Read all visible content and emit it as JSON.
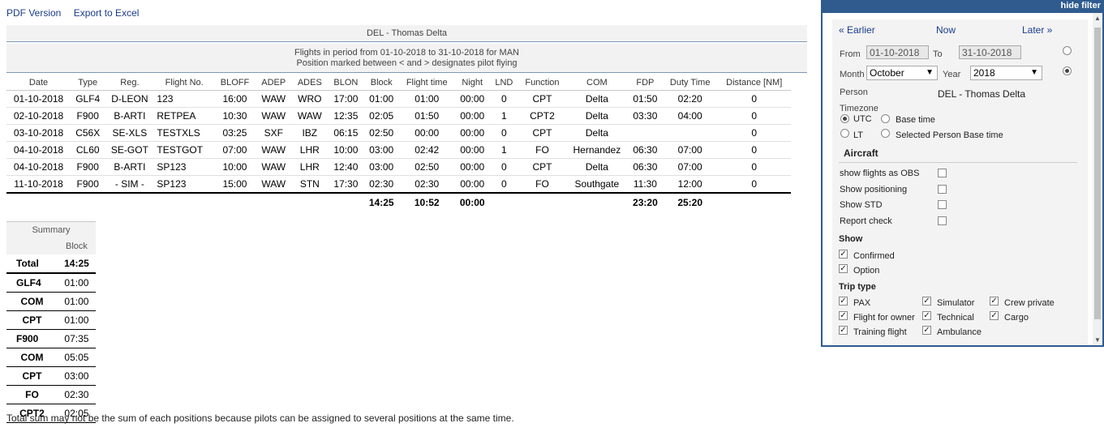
{
  "links": {
    "pdf": "PDF Version",
    "excel": "Export to Excel"
  },
  "report": {
    "person_header": "DEL - Thomas Delta",
    "period_line1": "Flights in period from 01-10-2018 to 31-10-2018 for MAN",
    "period_line2": "Position marked between < and > designates pilot flying",
    "columns": [
      "Date",
      "Type",
      "Reg.",
      "Flight No.",
      "BLOFF",
      "ADEP",
      "ADES",
      "BLON",
      "Block",
      "Flight time",
      "Night",
      "LND",
      "Function",
      "COM",
      "FDP",
      "Duty Time",
      "Distance [NM]"
    ],
    "rows": [
      [
        "01-10-2018",
        "GLF4",
        "D-LEON",
        "123",
        "16:00",
        "WAW",
        "WRO",
        "17:00",
        "01:00",
        "01:00",
        "00:00",
        "0",
        "CPT",
        "Delta",
        "01:50",
        "02:20",
        "0"
      ],
      [
        "02-10-2018",
        "F900",
        "B-ARTI",
        "RETPEA",
        "10:30",
        "WAW",
        "WAW",
        "12:35",
        "02:05",
        "01:50",
        "00:00",
        "1",
        "CPT2",
        "Delta",
        "03:30",
        "04:00",
        "0"
      ],
      [
        "03-10-2018",
        "C56X",
        "SE-XLS",
        "TESTXLS",
        "03:25",
        "SXF",
        "IBZ",
        "06:15",
        "02:50",
        "00:00",
        "00:00",
        "0",
        "CPT",
        "Delta",
        "",
        "",
        "0"
      ],
      [
        "04-10-2018",
        "CL60",
        "SE-GOT",
        "TESTGOT",
        "07:00",
        "WAW",
        "LHR",
        "10:00",
        "03:00",
        "02:42",
        "00:00",
        "1",
        "FO",
        "Hernandez",
        "06:30",
        "07:00",
        "0"
      ],
      [
        "04-10-2018",
        "F900",
        "B-ARTI",
        "SP123",
        "10:00",
        "WAW",
        "LHR",
        "12:40",
        "03:00",
        "02:50",
        "00:00",
        "0",
        "CPT",
        "Delta",
        "06:30",
        "07:00",
        "0"
      ],
      [
        "11-10-2018",
        "F900",
        "- SIM -",
        "SP123",
        "15:00",
        "WAW",
        "STN",
        "17:30",
        "02:30",
        "02:30",
        "00:00",
        "0",
        "FO",
        "Southgate",
        "11:30",
        "12:00",
        "0"
      ]
    ],
    "totals": {
      "block": "14:25",
      "flight_time": "10:52",
      "night": "00:00",
      "fdp": "23:20",
      "duty": "25:20"
    }
  },
  "summary": {
    "title": "Summary",
    "col": "Block",
    "total_label": "Total",
    "total_value": "14:25",
    "rows": [
      {
        "label": "GLF4",
        "value": "01:00",
        "kind": "type"
      },
      {
        "label": "COM",
        "value": "01:00",
        "kind": "sub"
      },
      {
        "label": "CPT",
        "value": "01:00",
        "kind": "sub"
      },
      {
        "label": "F900",
        "value": "07:35",
        "kind": "type"
      },
      {
        "label": "COM",
        "value": "05:05",
        "kind": "sub"
      },
      {
        "label": "CPT",
        "value": "03:00",
        "kind": "sub"
      },
      {
        "label": "FO",
        "value": "02:30",
        "kind": "sub"
      },
      {
        "label": "CPT2",
        "value": "02:05",
        "kind": "sub"
      }
    ]
  },
  "note": "Total sum may not be the sum of each positions because pilots can be assigned to several positions at the same time.",
  "filter": {
    "hide": "hide filter",
    "earlier": "« Earlier",
    "now": "Now",
    "later": "Later »",
    "from_label": "From",
    "from_value": "01-10-2018",
    "to_label": "To",
    "to_value": "31-10-2018",
    "month_label": "Month",
    "month_value": "October",
    "year_label": "Year",
    "year_value": "2018",
    "person_label": "Person",
    "person_value": "DEL - Thomas Delta",
    "timezone_label": "Timezone",
    "tz_utc": "UTC",
    "tz_base": "Base time",
    "tz_lt": "LT",
    "tz_selected": "Selected Person Base time",
    "aircraft_heading": "Aircraft",
    "opt_obs": "show flights as OBS",
    "opt_positioning": "Show positioning",
    "opt_std": "Show STD",
    "opt_report": "Report check",
    "show_heading": "Show",
    "show_confirmed": "Confirmed",
    "show_option": "Option",
    "trip_heading": "Trip type",
    "trip_pax": "PAX",
    "trip_simulator": "Simulator",
    "trip_crew_private": "Crew private",
    "trip_owner": "Flight for owner",
    "trip_technical": "Technical",
    "trip_cargo": "Cargo",
    "trip_training": "Training flight",
    "trip_ambulance": "Ambulance"
  }
}
